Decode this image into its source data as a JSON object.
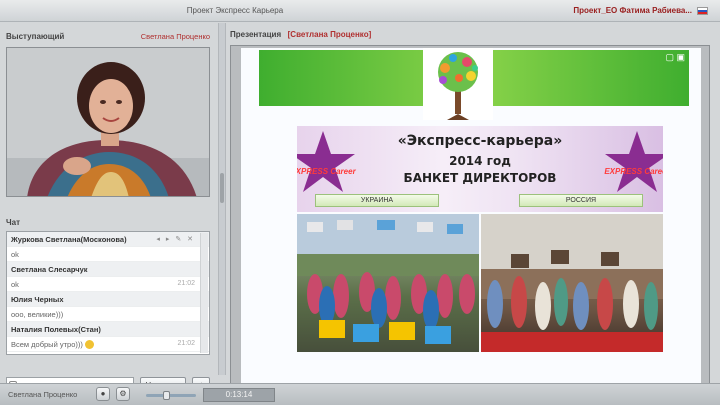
{
  "window": {
    "title": "Проект Экспресс Карьера",
    "user": "Проект_ЕО Фатима Рабиева...",
    "language_flag": "flag-ru-icon"
  },
  "speaker_panel": {
    "title": "Выступающий",
    "speaker_name": "Светлана Проценко"
  },
  "chat_panel": {
    "title": "Чат",
    "messages": [
      {
        "name": "Журкова Светлана(Москонова)",
        "text": "ok",
        "time": ""
      },
      {
        "name": "Светлана Слесарчук",
        "text": "ok",
        "time": "21:02"
      },
      {
        "name": "Юлия Черных",
        "text": "ооо, великие)))",
        "time": ""
      },
      {
        "name": "Наталия Полевых(Стан)",
        "text": "Всем добрый утро)))",
        "time": "21:02"
      }
    ],
    "input_placeholder": "",
    "send_label": "Написать"
  },
  "presentation_panel": {
    "title": "Презентация",
    "presenter": "[Светлана Проценко]",
    "slide": {
      "line1": "«Экспресс-карьера»",
      "line2": "2014 год",
      "line3": "БАНКЕТ ДИРЕКТОРОВ",
      "country_left": "УКРАИНА",
      "country_right": "РОССИЯ",
      "logo_text": "EXPRESS Career"
    }
  },
  "statusbar": {
    "user_name": "Светлана Проценко",
    "volume": 0.4,
    "time": "0:13:14"
  },
  "colors": {
    "accent_red": "#b03030",
    "slide_green": "#3fae2f",
    "banner_purple": "#8a2d91",
    "button_bg": "#d9dde0"
  }
}
